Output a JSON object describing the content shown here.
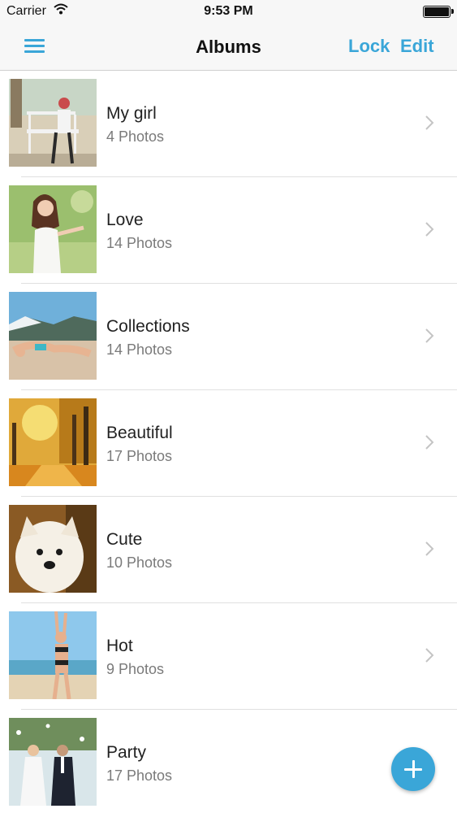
{
  "status_bar": {
    "carrier": "Carrier",
    "time": "9:53 PM"
  },
  "nav": {
    "title": "Albums",
    "lock_label": "Lock",
    "edit_label": "Edit"
  },
  "albums": [
    {
      "name": "My girl",
      "count": "4 Photos"
    },
    {
      "name": "Love",
      "count": "14 Photos"
    },
    {
      "name": "Collections",
      "count": "14 Photos"
    },
    {
      "name": "Beautiful",
      "count": "17 Photos"
    },
    {
      "name": "Cute",
      "count": "10 Photos"
    },
    {
      "name": "Hot",
      "count": "9 Photos"
    },
    {
      "name": "Party",
      "count": "17 Photos"
    }
  ],
  "colors": {
    "accent": "#3aa6d8"
  },
  "icons": {
    "menu": "hamburger-menu-icon",
    "chevron": "chevron-right-icon",
    "add": "plus-icon"
  }
}
